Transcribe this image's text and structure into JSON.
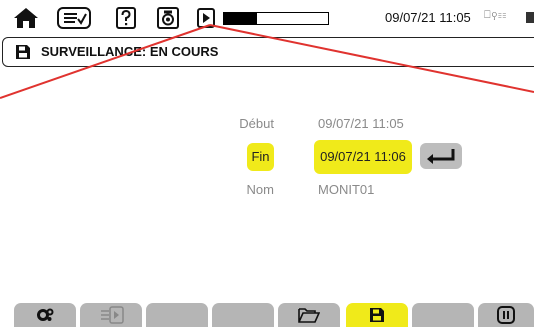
{
  "status_bar": {
    "datetime": "09/07/21 11:05",
    "recording_progress": 0.32,
    "connection_glyphs": "⎕⚲☷"
  },
  "title_bar": {
    "title": "SURVEILLANCE: EN COURS"
  },
  "fields": {
    "start_label": "Début",
    "start_value": "09/07/21 11:05",
    "end_label": "Fin",
    "end_value": "09/07/21 11:06",
    "name_label": "Nom",
    "name_value": "MONIT01"
  },
  "colors": {
    "highlight": "#f0ea1a",
    "tab_gray": "#b5b5b5",
    "annotation_red": "#e0332f"
  },
  "icons": {
    "top": [
      "home-icon",
      "checklist-icon",
      "help-icon",
      "camera-icon",
      "play-icon"
    ],
    "bottom": [
      "settings-gears-icon",
      "export-icon",
      "open-folder-icon",
      "save-icon",
      "pause-icon"
    ]
  }
}
